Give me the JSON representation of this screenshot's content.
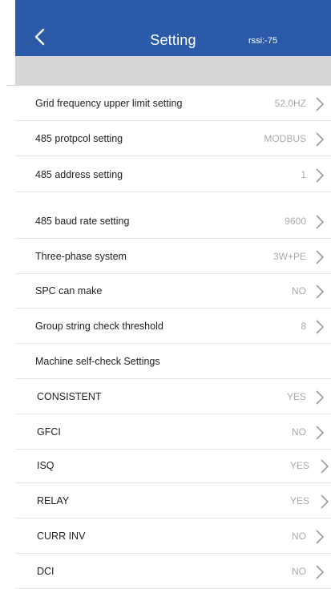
{
  "header": {
    "title": "Setting",
    "rssi": "rssi:-75",
    "back_icon": "chevron-left-icon",
    "background": "#2a5aa8"
  },
  "items": [
    {
      "label": "Grid frequency upper limit setting",
      "value": "52.0HZ"
    },
    {
      "label": "485 protpcol setting",
      "value": "MODBUS"
    },
    {
      "label": "485 address setting",
      "value": "1"
    },
    {
      "label": "485 baud rate setting",
      "value": "9600"
    },
    {
      "label": "Three-phase system",
      "value": "3W+PE"
    },
    {
      "label": "SPC can make",
      "value": "NO"
    },
    {
      "label": "Group string check threshold",
      "value": "8"
    }
  ],
  "section": {
    "label": "Machine self-check Settings"
  },
  "self_check_items": [
    {
      "label": "CONSISTENT",
      "value": "YES"
    },
    {
      "label": "GFCI",
      "value": "NO"
    },
    {
      "label": "ISQ",
      "value": "YES"
    },
    {
      "label": "RELAY",
      "value": "YES"
    },
    {
      "label": "CURR INV",
      "value": "NO"
    },
    {
      "label": "DCI",
      "value": "NO"
    }
  ]
}
